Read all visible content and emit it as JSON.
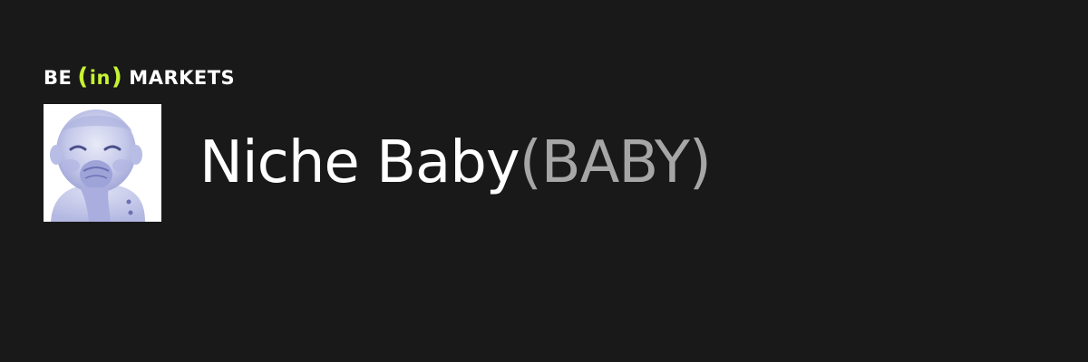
{
  "brand": {
    "prefix": "BE",
    "open_bracket": "(",
    "middle": "in",
    "close_bracket": ")",
    "suffix": "MARKETS",
    "accent_color": "#c6f432"
  },
  "token": {
    "name": "Niche Baby",
    "ticker": "(BABY)"
  },
  "colors": {
    "background": "#191919",
    "name": "#ffffff",
    "ticker": "#a6a6a6"
  }
}
